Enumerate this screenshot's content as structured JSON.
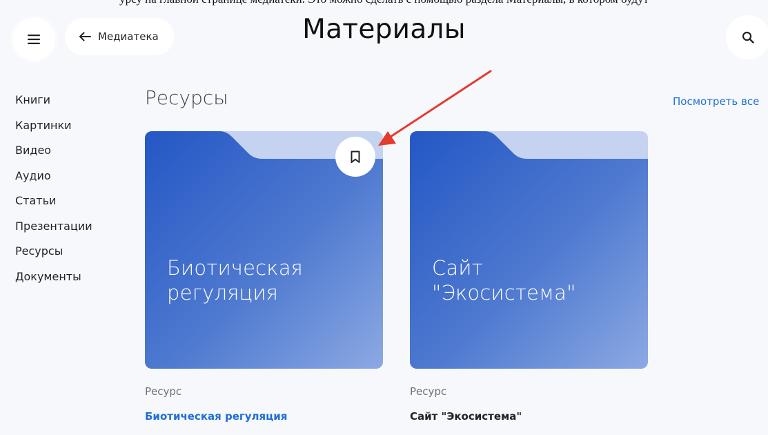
{
  "top_crop_text": "урсу на главной странице медиатеки. Это можно сделать с помощью раздела Материалы, в котором будут",
  "header": {
    "title": "Материалы",
    "back_label": "Медиатека"
  },
  "sidebar": {
    "items": [
      {
        "label": "Книги"
      },
      {
        "label": "Картинки"
      },
      {
        "label": "Видео"
      },
      {
        "label": "Аудио"
      },
      {
        "label": "Статьи"
      },
      {
        "label": "Презентации"
      },
      {
        "label": "Ресурсы"
      },
      {
        "label": "Документы"
      }
    ]
  },
  "section": {
    "title": "Ресурсы",
    "view_all": "Посмотреть все"
  },
  "cards": [
    {
      "cover_text": "Биотическая\nрегуляция",
      "type": "Ресурс",
      "name": "Биотическая регуляция",
      "name_color": "#1e6fd6",
      "bookmarked": true
    },
    {
      "cover_text": "Сайт\n\"Экосистема\"",
      "type": "Ресурс",
      "name": "Сайт \"Экосистема\"",
      "name_color": "#1f2328",
      "bookmarked": false
    }
  ],
  "colors": {
    "accent": "#1e6fd6",
    "card_gradient_start": "#2457c5",
    "card_gradient_end": "#8ca9e3",
    "folder_tab": "#c5d3f0",
    "annotation_arrow": "#e53a2f"
  },
  "icons": {
    "menu": "hamburger-icon",
    "back": "arrow-left-icon",
    "search": "search-icon",
    "bookmark": "bookmark-icon"
  }
}
